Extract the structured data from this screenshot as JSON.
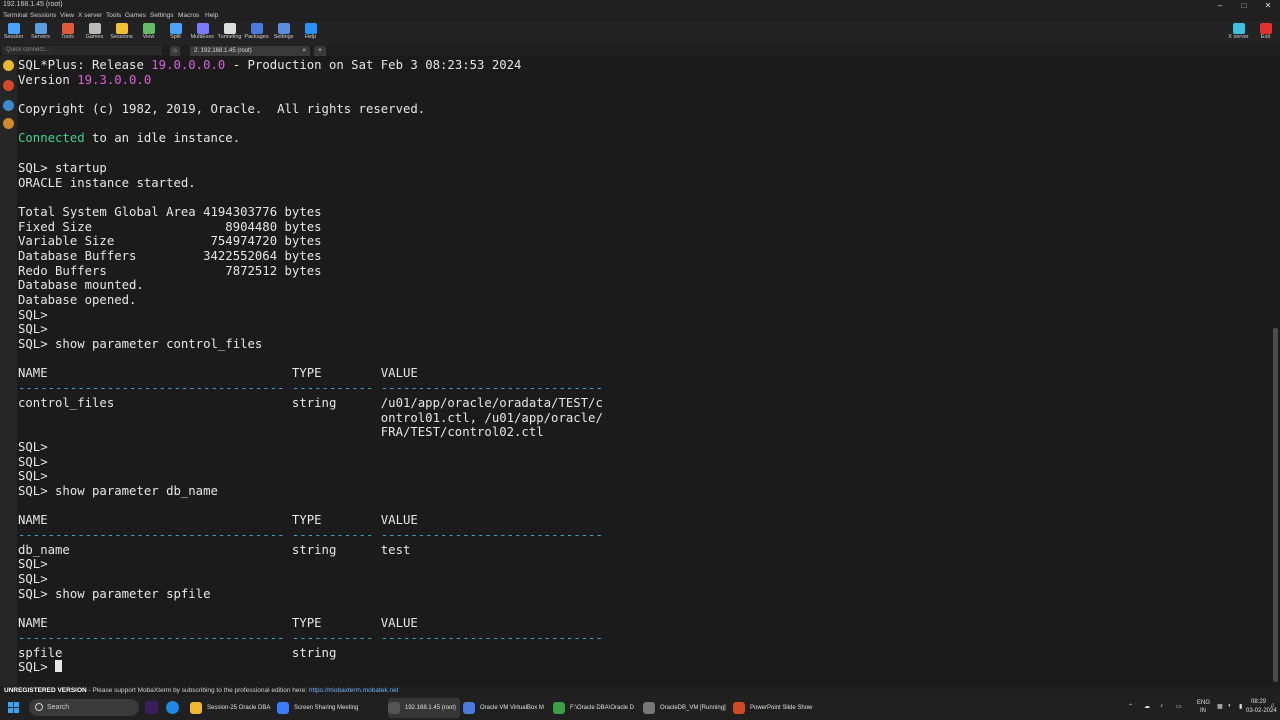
{
  "window": {
    "title": "192.168.1.45 (root)",
    "controls": [
      "–",
      "□",
      "✕"
    ]
  },
  "menu": [
    "Terminal",
    "Sessions",
    "View",
    "X server",
    "Tools",
    "Games",
    "Settings",
    "Macros",
    "Help"
  ],
  "toolbar": [
    {
      "label": "Session",
      "icon": "session-icon",
      "color": "#4aa3ff"
    },
    {
      "label": "Servers",
      "icon": "servers-icon",
      "color": "#5aa0e0"
    },
    {
      "label": "Tools",
      "icon": "tools-icon",
      "color": "#e05a3a"
    },
    {
      "label": "Games",
      "icon": "games-icon",
      "color": "#bbbbbb"
    },
    {
      "label": "Sessions",
      "icon": "star-icon",
      "color": "#f2c230"
    },
    {
      "label": "View",
      "icon": "view-icon",
      "color": "#66bb66"
    },
    {
      "label": "Split",
      "icon": "split-icon",
      "color": "#4aa3ff"
    },
    {
      "label": "MultiExec",
      "icon": "multiexec-icon",
      "color": "#7a7aff"
    },
    {
      "label": "Tunneling",
      "icon": "tunneling-icon",
      "color": "#dddddd"
    },
    {
      "label": "Packages",
      "icon": "packages-icon",
      "color": "#4a7adf"
    },
    {
      "label": "Settings",
      "icon": "settings-icon",
      "color": "#5a8fdf"
    },
    {
      "label": "Help",
      "icon": "help-icon",
      "color": "#2a8fff"
    }
  ],
  "toolbar_right": [
    {
      "label": "X server",
      "icon": "x-server-icon",
      "color": "#40c0e0"
    },
    {
      "label": "Exit",
      "icon": "exit-icon",
      "color": "#e03030"
    }
  ],
  "tabs": {
    "quick_connect": "Quick connect...",
    "session_tab": "2. 192.168.1.45 (root)"
  },
  "terminal": {
    "cursor": "▌",
    "prompt_last": "SQL> ",
    "lines": [
      [
        {
          "t": "SQL*Plus: Release "
        },
        {
          "t": "19.0.0.0.0",
          "c": "hl"
        },
        {
          "t": " - Production on Sat Feb 3 08:23:53 2024"
        }
      ],
      [
        {
          "t": "Version "
        },
        {
          "t": "19.3.0.0.0",
          "c": "hl"
        }
      ],
      [
        {
          "t": ""
        }
      ],
      [
        {
          "t": "Copyright (c) 1982, 2019, Oracle.  All rights reserved."
        }
      ],
      [
        {
          "t": ""
        }
      ],
      [
        {
          "t": "Connected",
          "c": "grn"
        },
        {
          "t": " to an idle instance."
        }
      ],
      [
        {
          "t": ""
        }
      ],
      [
        {
          "t": "SQL> startup"
        }
      ],
      [
        {
          "t": "ORACLE instance started."
        }
      ],
      [
        {
          "t": ""
        }
      ],
      [
        {
          "t": "Total System Global Area 4194303776 bytes"
        }
      ],
      [
        {
          "t": "Fixed Size                  8904480 bytes"
        }
      ],
      [
        {
          "t": "Variable Size             754974720 bytes"
        }
      ],
      [
        {
          "t": "Database Buffers         3422552064 bytes"
        }
      ],
      [
        {
          "t": "Redo Buffers                7872512 bytes"
        }
      ],
      [
        {
          "t": "Database mounted."
        }
      ],
      [
        {
          "t": "Database opened."
        }
      ],
      [
        {
          "t": "SQL>"
        }
      ],
      [
        {
          "t": "SQL>"
        }
      ],
      [
        {
          "t": "SQL> show parameter control_files"
        }
      ],
      [
        {
          "t": ""
        }
      ],
      [
        {
          "t": "NAME                                 TYPE        VALUE"
        }
      ],
      [
        {
          "t": "------------------------------------ ----------- ------------------------------",
          "c": "dash"
        }
      ],
      [
        {
          "t": "control_files                        string      /u01/app/oracle/oradata/TEST/c"
        }
      ],
      [
        {
          "t": "                                                 ontrol01.ctl, /u01/app/oracle/"
        }
      ],
      [
        {
          "t": "                                                 FRA/TEST/control02.ctl"
        }
      ],
      [
        {
          "t": "SQL>"
        }
      ],
      [
        {
          "t": "SQL>"
        }
      ],
      [
        {
          "t": "SQL>"
        }
      ],
      [
        {
          "t": "SQL> show parameter db_name"
        }
      ],
      [
        {
          "t": ""
        }
      ],
      [
        {
          "t": "NAME                                 TYPE        VALUE"
        }
      ],
      [
        {
          "t": "------------------------------------ ----------- ------------------------------",
          "c": "dash"
        }
      ],
      [
        {
          "t": "db_name                              string      test"
        }
      ],
      [
        {
          "t": "SQL>"
        }
      ],
      [
        {
          "t": "SQL>"
        }
      ],
      [
        {
          "t": "SQL> show parameter spfile"
        }
      ],
      [
        {
          "t": ""
        }
      ],
      [
        {
          "t": "NAME                                 TYPE        VALUE"
        }
      ],
      [
        {
          "t": "------------------------------------ ----------- ------------------------------",
          "c": "dash"
        }
      ],
      [
        {
          "t": "spfile                               string"
        }
      ]
    ]
  },
  "statusbar": {
    "label": "UNREGISTERED VERSION",
    "message": "  -  Please support MobaXterm by subscribing to the professional edition here:  ",
    "link": "https://mobaxterm.mobatek.net"
  },
  "taskbar": {
    "search_placeholder": "Search",
    "apps": [
      {
        "label": "Session-25 Oracle DBA",
        "icon": "explorer-icon",
        "color": "#f2b830"
      },
      {
        "label": "Screen Sharing Meeting",
        "icon": "meeting-icon",
        "color": "#3a7aff"
      },
      {
        "label": "192.168.1.45 (root)",
        "icon": "mobaxterm-icon",
        "color": "#555555"
      },
      {
        "label": "Oracle VM VirtualBox M",
        "icon": "virtualbox-icon",
        "color": "#4a7adf"
      },
      {
        "label": "F:\\Oracle DBA\\Oracle D",
        "icon": "notepad-icon",
        "color": "#3aa040"
      },
      {
        "label": "OracleDB_VM [Running]",
        "icon": "vm-icon",
        "color": "#777777"
      },
      {
        "label": "PowerPoint Slide Show",
        "icon": "powerpoint-icon",
        "color": "#d24726"
      }
    ],
    "tray": {
      "lang": "ENG",
      "region": "IN",
      "time": "08:29",
      "date": "03-02-2024"
    }
  }
}
